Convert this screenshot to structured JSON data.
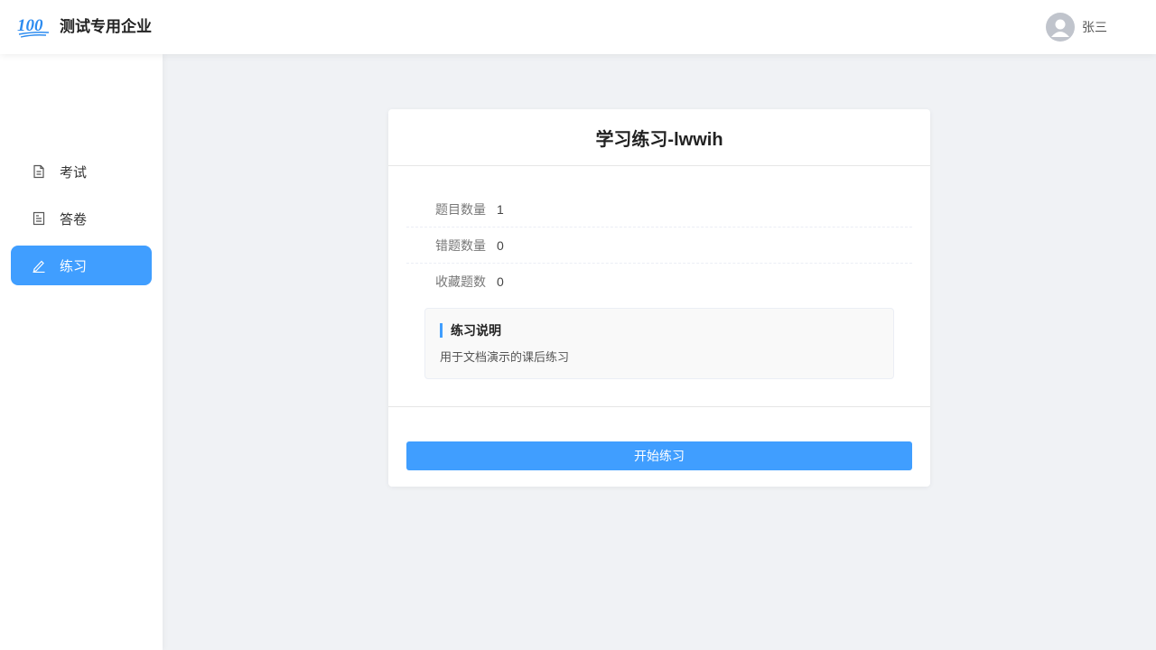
{
  "header": {
    "logo_text": "100",
    "company_name": "测试专用企业",
    "user_name": "张三"
  },
  "sidebar": {
    "items": [
      {
        "label": "考试",
        "icon": "document-icon",
        "active": false
      },
      {
        "label": "答卷",
        "icon": "answer-sheet-icon",
        "active": false
      },
      {
        "label": "练习",
        "icon": "pen-icon",
        "active": true
      }
    ]
  },
  "practice": {
    "title": "学习练习-lwwih",
    "stats": [
      {
        "label": "题目数量",
        "value": "1"
      },
      {
        "label": "错题数量",
        "value": "0"
      },
      {
        "label": "收藏题数",
        "value": "0"
      }
    ],
    "description_title": "练习说明",
    "description_text": "用于文档演示的课后练习",
    "start_button": "开始练习"
  },
  "colors": {
    "accent": "#409eff",
    "background": "#f0f2f5"
  }
}
